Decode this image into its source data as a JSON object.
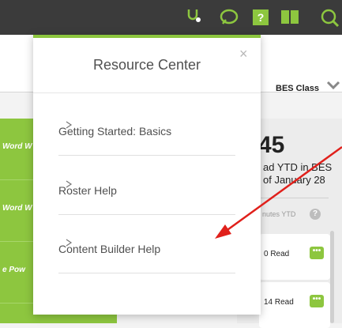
{
  "header": {
    "icons": [
      "stethoscope-icon",
      "chat-bubble-icon",
      "help-icon",
      "book-icon",
      "search-icon"
    ],
    "help_badge": "?",
    "class_selector": "BES Class"
  },
  "sidebar": {
    "items": [
      {
        "label": "Word W"
      },
      {
        "label": "Word W"
      },
      {
        "label": "e Pow"
      }
    ]
  },
  "stats": {
    "big_number": "45",
    "line1": "ad YTD in BES",
    "line2": "of January 28",
    "minutes_label": "nutes YTD",
    "help": "?",
    "rows": [
      {
        "label": "0 Read",
        "more": "•••"
      },
      {
        "label": "14 Read",
        "more": "•••"
      }
    ]
  },
  "resource_center": {
    "title": "Resource Center",
    "close": "×",
    "items": [
      {
        "label": "Getting Started: Basics"
      },
      {
        "label": "Roster Help"
      },
      {
        "label": "Content Builder Help"
      }
    ]
  },
  "colors": {
    "accent": "#8dc63f",
    "topbar": "#3b3b3b",
    "annotation_arrow": "#e0201b"
  }
}
